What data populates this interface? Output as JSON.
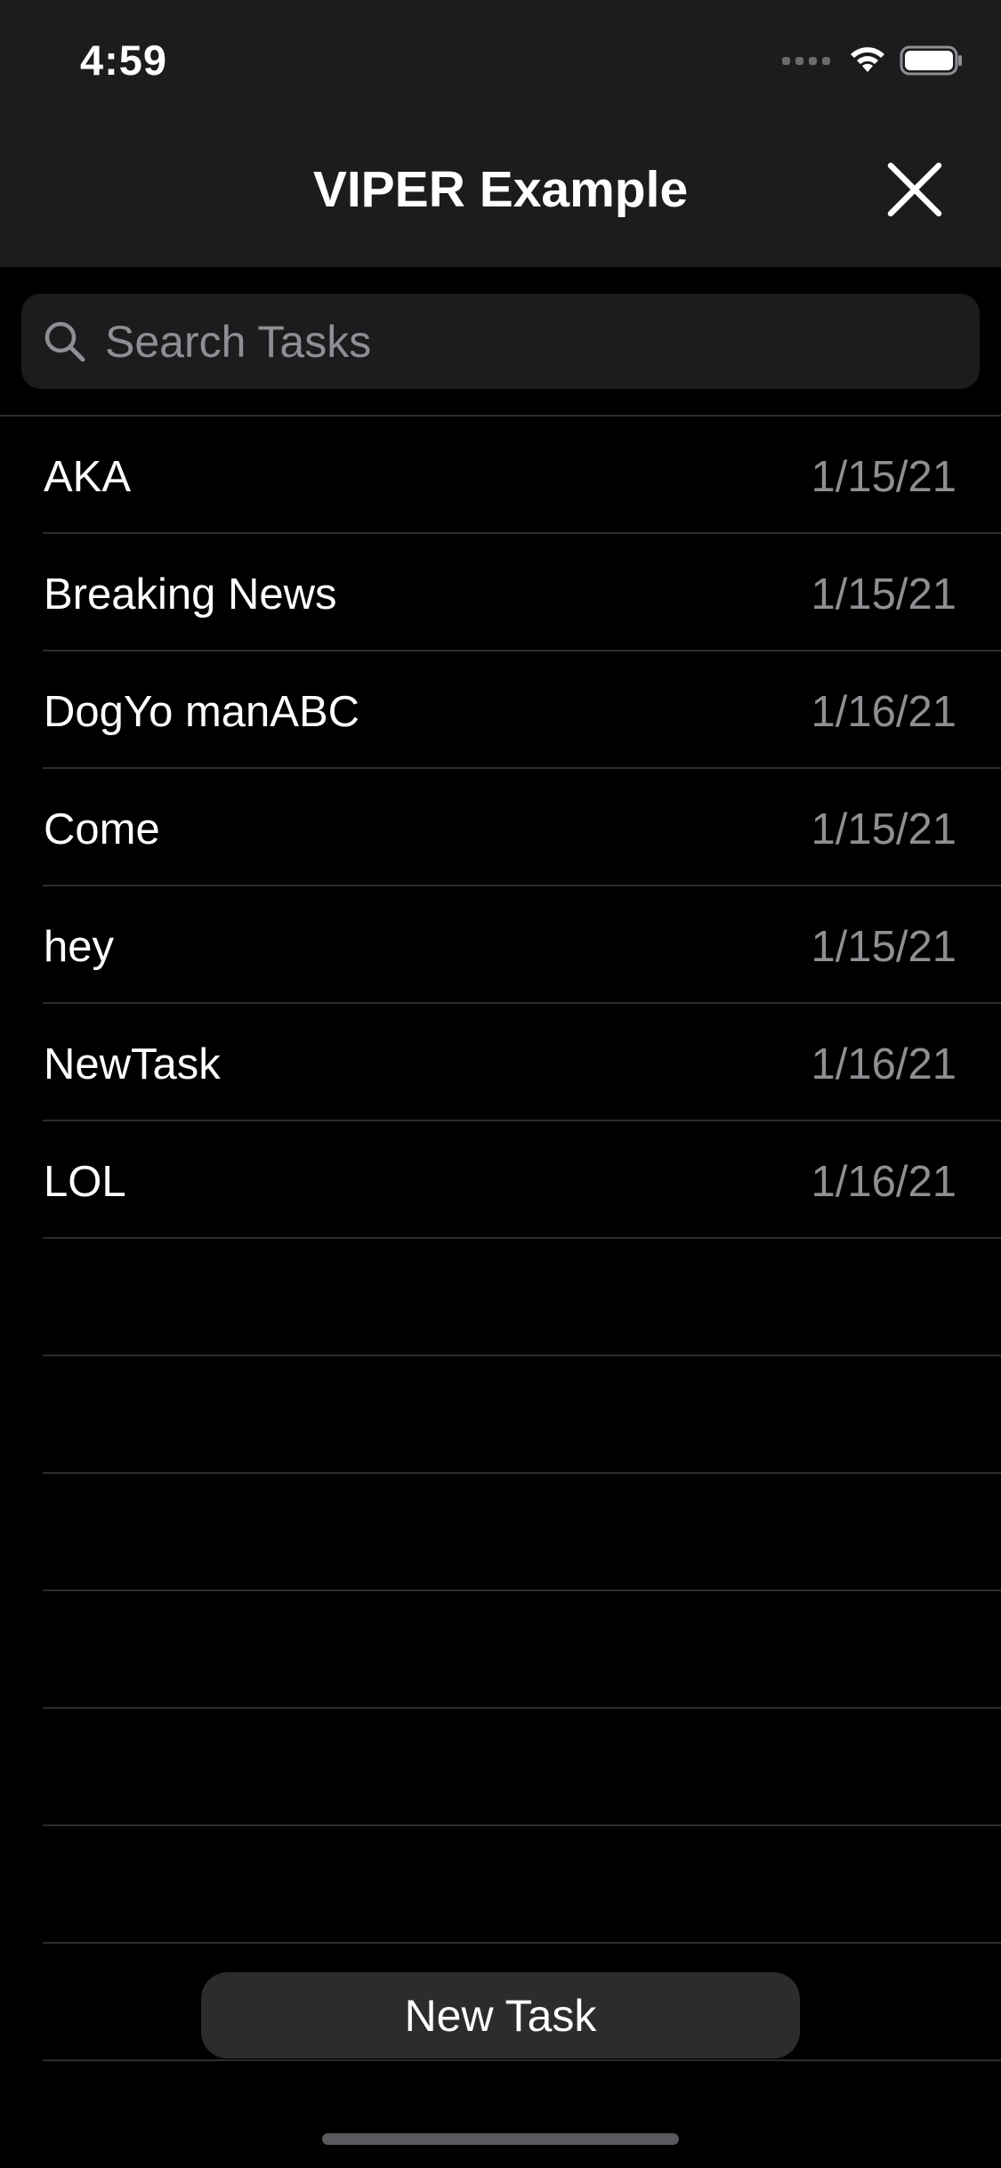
{
  "status_bar": {
    "time": "4:59"
  },
  "nav": {
    "title": "VIPER Example",
    "close_icon": "close-icon"
  },
  "search": {
    "placeholder": "Search Tasks",
    "value": "",
    "icon": "search-icon"
  },
  "tasks": [
    {
      "title": "AKA",
      "date": "1/15/21"
    },
    {
      "title": "Breaking News",
      "date": "1/15/21"
    },
    {
      "title": "DogYo manABC",
      "date": "1/16/21"
    },
    {
      "title": "Come",
      "date": "1/15/21"
    },
    {
      "title": "hey",
      "date": "1/15/21"
    },
    {
      "title": "NewTask",
      "date": "1/16/21"
    },
    {
      "title": "LOL",
      "date": "1/16/21"
    }
  ],
  "new_task_button": {
    "label": "New Task"
  },
  "colors": {
    "background": "#000000",
    "bar": "#1c1c1e",
    "separator": "#2c2c2e",
    "secondary_text": "#8e8e93",
    "button": "#2c2c2e"
  }
}
